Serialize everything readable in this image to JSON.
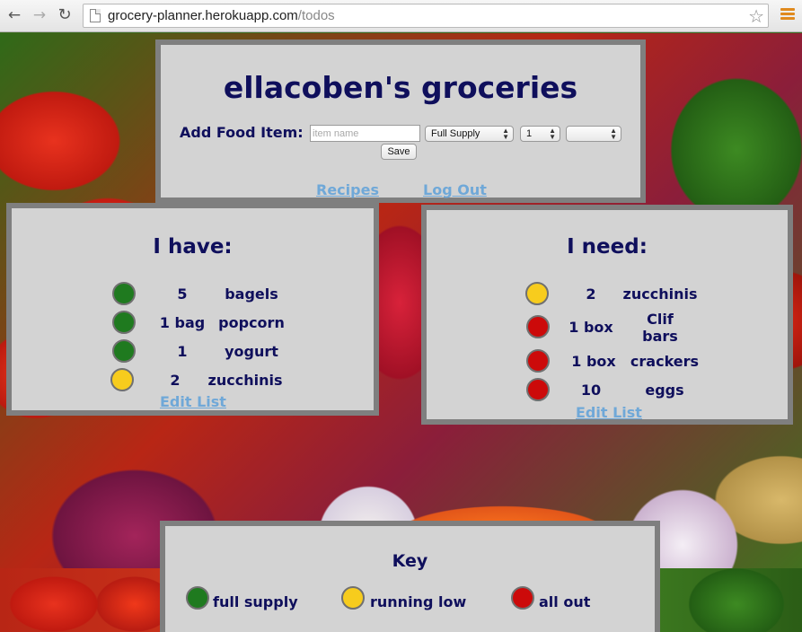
{
  "browser": {
    "url_host": "grocery-planner.herokuapp.com",
    "url_path": "/todos",
    "back_icon": "←",
    "forward_icon": "→",
    "reload_icon": "↻",
    "star_icon": "☆"
  },
  "header": {
    "title": "ellacoben's groceries",
    "add_label": "Add Food Item:",
    "item_placeholder": "item name",
    "supply_value": "Full Supply",
    "quantity_value": "1",
    "unit_value": "",
    "save_label": "Save",
    "recipes_link": "Recipes",
    "logout_link": "Log Out"
  },
  "have": {
    "heading": "I have:",
    "items": [
      {
        "status": "full supply",
        "color": "green",
        "qty": "5",
        "name": "bagels"
      },
      {
        "status": "full supply",
        "color": "green",
        "qty": "1 bag",
        "name": "popcorn"
      },
      {
        "status": "full supply",
        "color": "green",
        "qty": "1",
        "name": "yogurt"
      },
      {
        "status": "running low",
        "color": "yellow",
        "qty": "2",
        "name": "zucchinis"
      }
    ],
    "edit_link": "Edit List"
  },
  "need": {
    "heading": "I need:",
    "items": [
      {
        "status": "running low",
        "color": "yellow",
        "qty": "2",
        "name": "zucchinis"
      },
      {
        "status": "all out",
        "color": "red",
        "qty": "1 box",
        "name": "Clif bars"
      },
      {
        "status": "all out",
        "color": "red",
        "qty": "1 box",
        "name": "crackers"
      },
      {
        "status": "all out",
        "color": "red",
        "qty": "10",
        "name": "eggs"
      }
    ],
    "edit_link": "Edit List"
  },
  "key": {
    "title": "Key",
    "entries": [
      {
        "label": "full supply",
        "color": "#1f7a1f"
      },
      {
        "label": "running low",
        "color": "#f7cc1d"
      },
      {
        "label": "all out",
        "color": "#cc0a0a"
      }
    ]
  },
  "colors": {
    "text_navy": "#0f0f5c",
    "link_blue": "#6fa8d8",
    "panel_bg": "#d3d3d3",
    "panel_border": "#7f7f7f"
  }
}
